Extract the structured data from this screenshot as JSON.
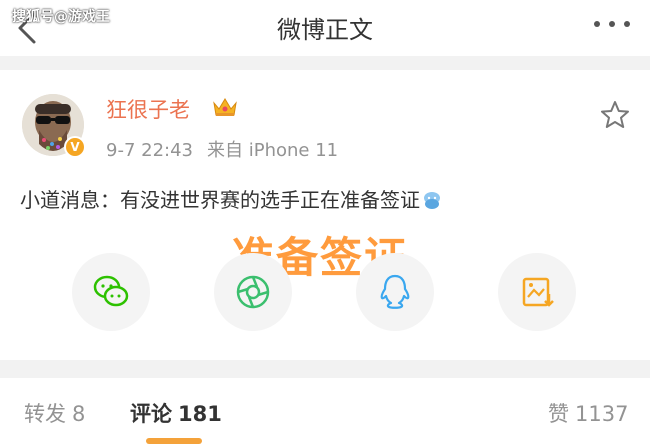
{
  "watermark": "搜狐号@游戏王",
  "header": {
    "title": "微博正文"
  },
  "post": {
    "username": "狂很子老",
    "timestamp": "9-7 22:43",
    "source": "来自 iPhone 11",
    "text": "小道消息：有没进世界赛的选手正在准备签证",
    "overlay_text": "准备签证"
  },
  "share_targets": [
    {
      "name": "wechat",
      "icon": "wechat-icon",
      "color": "#2dc100"
    },
    {
      "name": "moments",
      "icon": "moments-icon",
      "color": "#3bbf6e"
    },
    {
      "name": "qq",
      "icon": "qq-icon",
      "color": "#3aa7ef"
    },
    {
      "name": "save-image",
      "icon": "image-save-icon",
      "color": "#f5a623"
    }
  ],
  "tabs": [
    {
      "label": "转发",
      "count": "8"
    },
    {
      "label": "评论",
      "count": "181"
    },
    {
      "label": "赞",
      "count": "1137"
    }
  ],
  "colors": {
    "accent": "#eb7350",
    "tab_underline": "#f4a23a",
    "overlay": "#ff9b3d"
  }
}
